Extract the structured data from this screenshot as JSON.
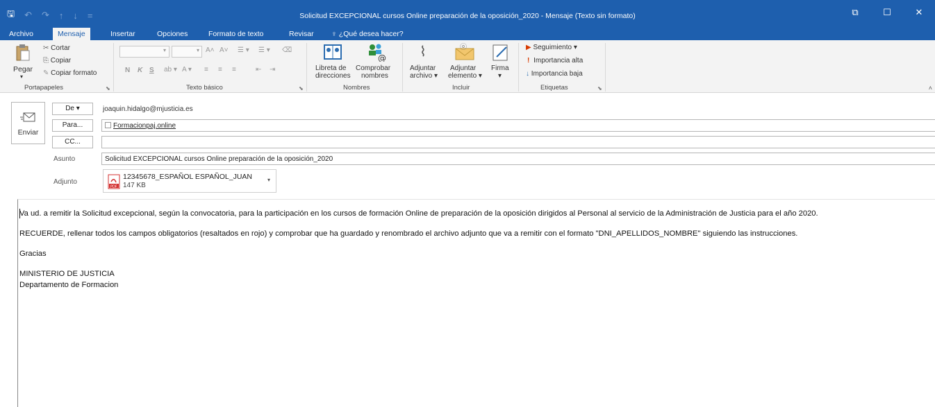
{
  "window": {
    "title": "Solicitud EXCEPCIONAL cursos Online preparación de la oposición_2020 - Mensaje (Texto sin formato)",
    "quick_access": {
      "save": "🖫",
      "undo": "↶",
      "redo": "↷",
      "up": "↑",
      "down": "↓",
      "customize": "="
    },
    "controls": {
      "ribbon_options": "⧉",
      "restore": "☐",
      "close": "✕"
    }
  },
  "tabs": [
    "Archivo",
    "Mensaje",
    "Insertar",
    "Opciones",
    "Formato de texto",
    "Revisar"
  ],
  "active_tab": "Mensaje",
  "tell_me": "¿Qué desea hacer?",
  "ribbon": {
    "clipboard": {
      "paste": "Pegar",
      "cut": "Cortar",
      "copy": "Copiar",
      "format_painter": "Copiar formato",
      "group": "Portapapeles"
    },
    "basic_text": {
      "bold": "N",
      "italic": "K",
      "underline": "S",
      "group": "Texto básico"
    },
    "names": {
      "address_book_1": "Libreta de",
      "address_book_2": "direcciones",
      "check_names_1": "Comprobar",
      "check_names_2": "nombres",
      "group": "Nombres"
    },
    "include": {
      "attach_file_1": "Adjuntar",
      "attach_file_2": "archivo ▾",
      "attach_item_1": "Adjuntar",
      "attach_item_2": "elemento ▾",
      "signature_1": "Firma",
      "signature_2": "▾",
      "group": "Incluir"
    },
    "tags": {
      "followup": "Seguimiento ▾",
      "high": "Importancia alta",
      "low": "Importancia baja",
      "group": "Etiquetas"
    }
  },
  "header": {
    "send": "Enviar",
    "from_button": "De ▾",
    "from_value": "joaquin.hidalgo@mjusticia.es",
    "to_button": "Para...",
    "to_value": "Formacionpaj.online",
    "cc_button": "CC...",
    "cc_value": "",
    "subject_label": "Asunto",
    "subject_value": "Solicitud EXCEPCIONAL cursos Online preparación de la oposición_2020",
    "attachment_label": "Adjunto",
    "attachment_name": "12345678_ESPAÑOL ESPAÑOL_JUAN",
    "attachment_size": "147 KB",
    "attachment_type": "PDF"
  },
  "body": {
    "p1": "Va ud. a remitir la Solicitud excepcional, según la convocatoria, para la participación en los cursos de formación Online de preparación de la oposición dirigidos al Personal al servicio de la Administración de Justicia para el año 2020.",
    "p2": "RECUERDE, rellenar todos los campos obligatorios (resaltados en rojo) y comprobar que ha guardado y renombrado el archivo adjunto que va a remitir con el formato \"DNI_APELLIDOS_NOMBRE\" siguiendo las instrucciones.",
    "p3": "Gracias",
    "p4a": "MINISTERIO DE JUSTICIA",
    "p4b": "Departamento de Formacion"
  },
  "colors": {
    "accent": "#1e5fae",
    "ribbon_bg": "#f3f3f3",
    "flag_red": "#d83b01",
    "pdf_red": "#d32f2f"
  }
}
